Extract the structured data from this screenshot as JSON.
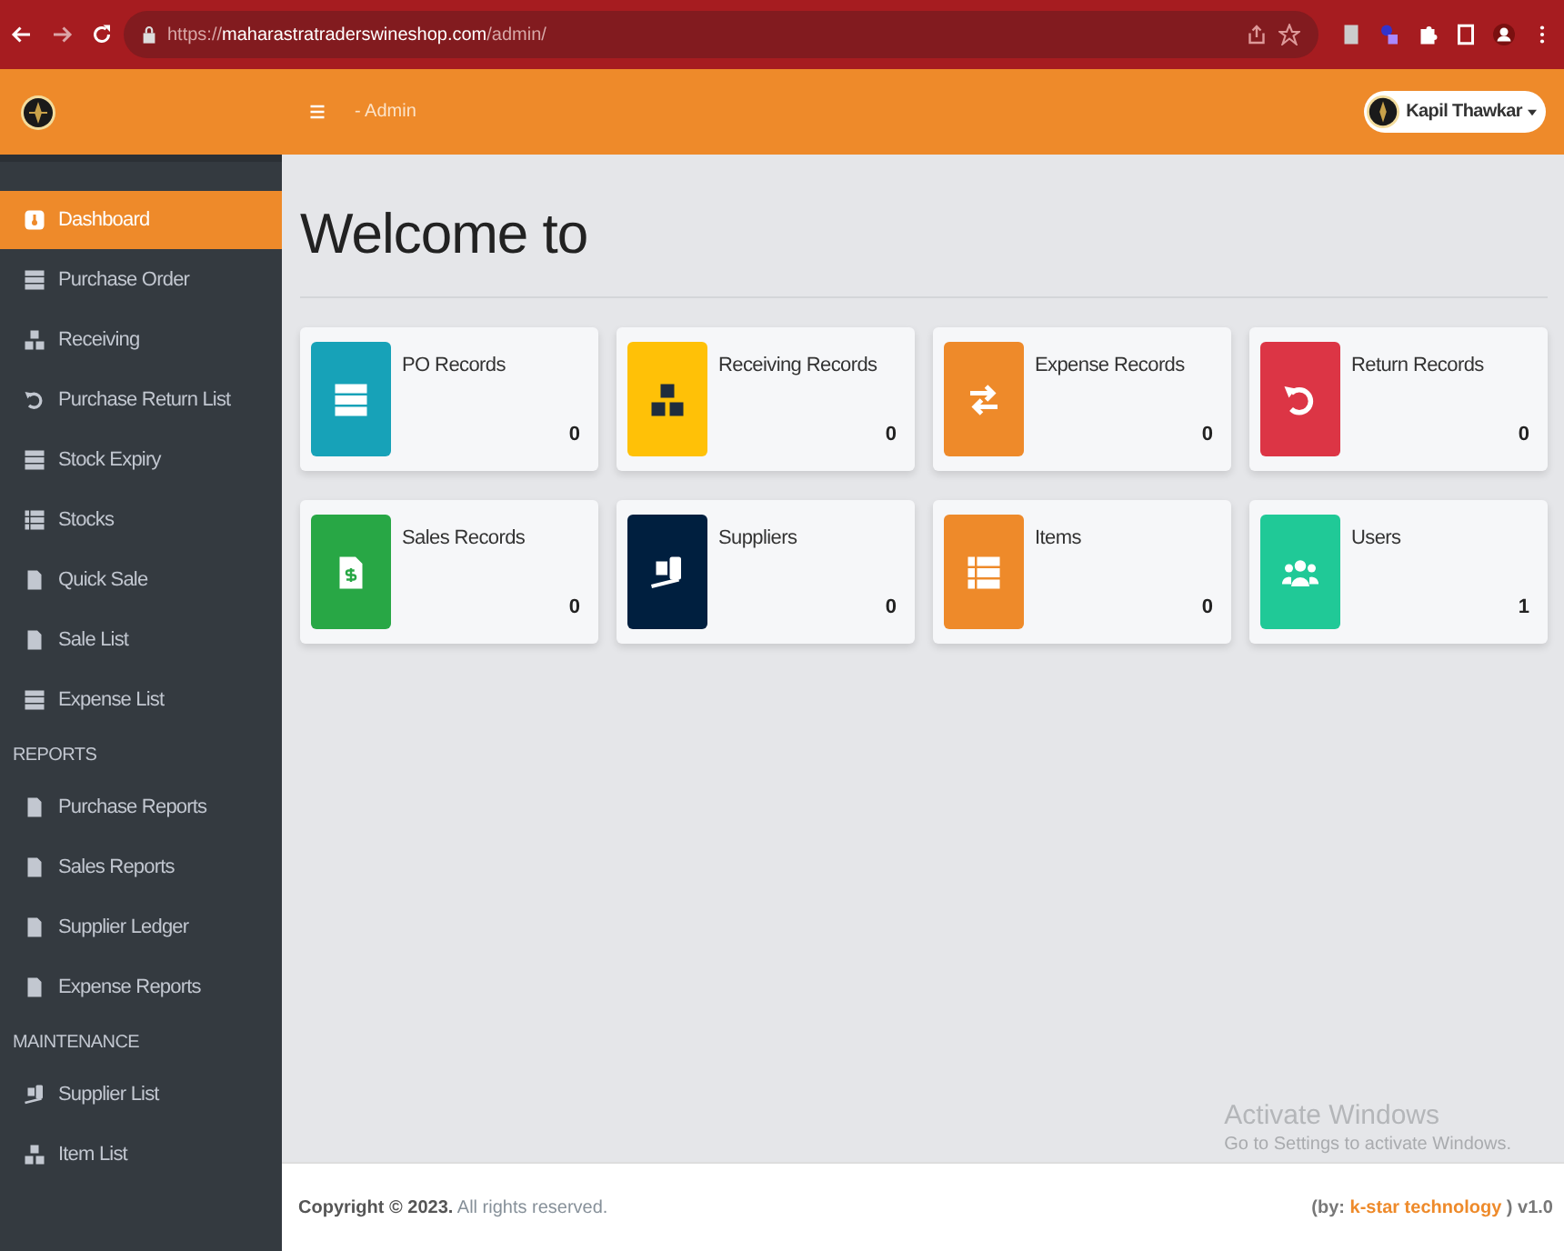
{
  "browser": {
    "url_scheme": "https://",
    "url_host": "maharastratraderswineshop.com",
    "url_path": "/admin/"
  },
  "header": {
    "breadcrumb": "- Admin",
    "user_name": "Kapil Thawkar"
  },
  "sidebar": {
    "sections": [
      {
        "items": [
          {
            "label": "Dashboard",
            "kind": "dashboard",
            "selected": true
          },
          {
            "label": "Purchase Order",
            "kind": "table",
            "selected": false
          },
          {
            "label": "Receiving",
            "kind": "boxes",
            "selected": false
          },
          {
            "label": "Purchase Return List",
            "kind": "undo",
            "selected": false
          },
          {
            "label": "Stock Expiry",
            "kind": "table",
            "selected": false
          },
          {
            "label": "Stocks",
            "kind": "list",
            "selected": false
          },
          {
            "label": "Quick Sale",
            "kind": "file",
            "selected": false
          },
          {
            "label": "Sale List",
            "kind": "file",
            "selected": false
          },
          {
            "label": "Expense List",
            "kind": "table",
            "selected": false
          }
        ]
      },
      {
        "heading": "REPORTS",
        "items": [
          {
            "label": "Purchase Reports",
            "kind": "file",
            "selected": false
          },
          {
            "label": "Sales Reports",
            "kind": "file",
            "selected": false
          },
          {
            "label": "Supplier Ledger",
            "kind": "file",
            "selected": false
          },
          {
            "label": "Expense Reports",
            "kind": "file",
            "selected": false
          }
        ]
      },
      {
        "heading": "MAINTENANCE",
        "items": [
          {
            "label": "Supplier List",
            "kind": "dolly",
            "selected": false
          },
          {
            "label": "Item List",
            "kind": "boxes",
            "selected": false
          }
        ]
      }
    ]
  },
  "main": {
    "title": "Welcome to",
    "cards": [
      {
        "label": "PO Records",
        "count": "0",
        "kind": "table",
        "color": "#17a2b8"
      },
      {
        "label": "Receiving Records",
        "count": "0",
        "kind": "boxes",
        "color": "#ffc107"
      },
      {
        "label": "Expense Records",
        "count": "0",
        "kind": "exchange",
        "color": "#ee8a2a"
      },
      {
        "label": "Return Records",
        "count": "0",
        "kind": "undo",
        "color": "#dc3545"
      },
      {
        "label": "Sales Records",
        "count": "0",
        "kind": "invoice",
        "color": "#28a745"
      },
      {
        "label": "Suppliers",
        "count": "0",
        "kind": "dolly",
        "color": "#001f3f"
      },
      {
        "label": "Items",
        "count": "0",
        "kind": "list",
        "color": "#ee8a2a"
      },
      {
        "label": "Users",
        "count": "1",
        "kind": "users",
        "color": "#20c997"
      }
    ]
  },
  "footer": {
    "copyright": "**Copyright © 2023.** All rights reserved.",
    "credit_prefix": "(by:",
    "credit_link": "k-star technology",
    "credit_suffix": ") v1.0"
  },
  "os_watermark": {
    "title": "Activate Windows",
    "subtitle": "Go to Settings to activate Windows."
  }
}
